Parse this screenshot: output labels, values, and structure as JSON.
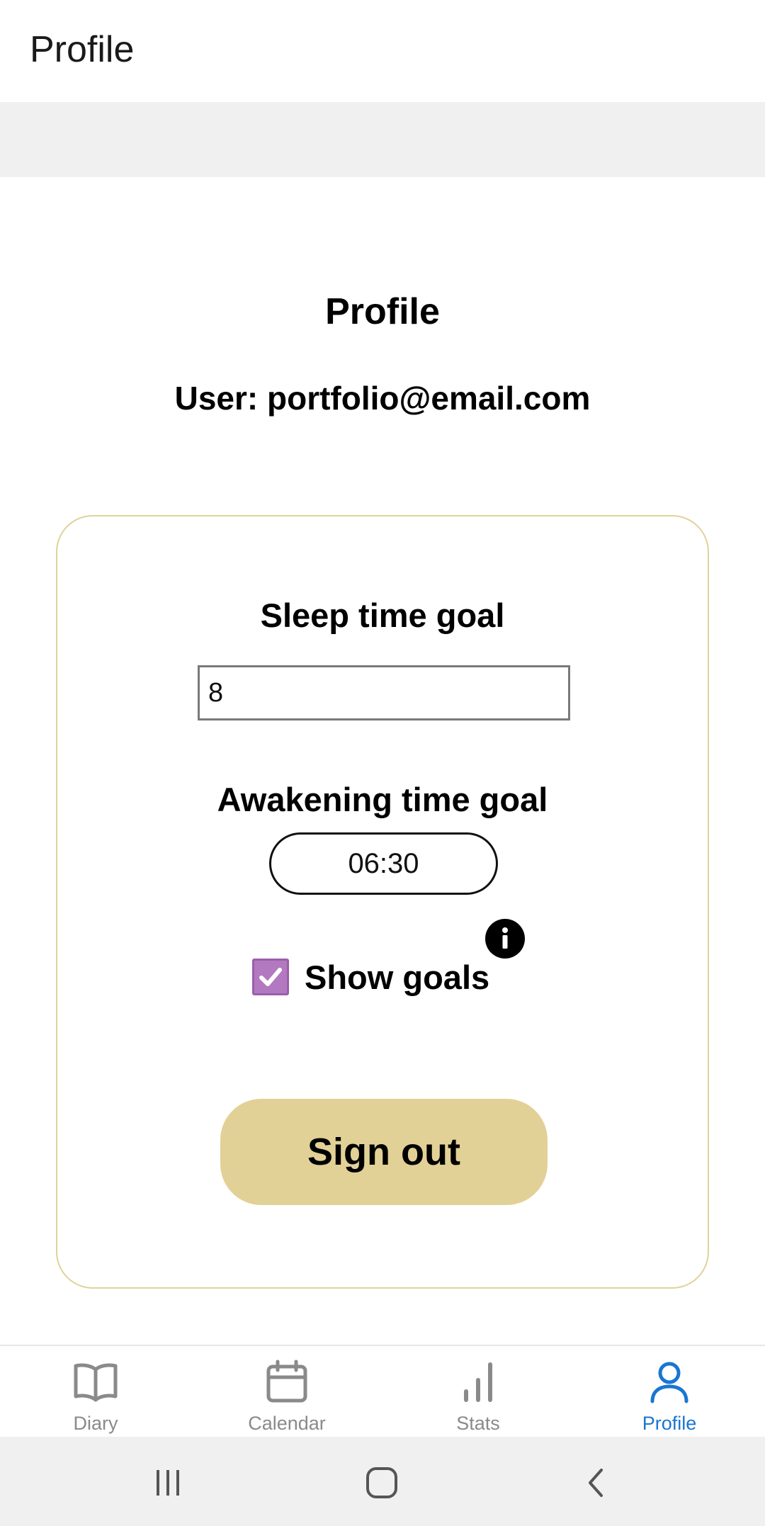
{
  "header": {
    "title": "Profile"
  },
  "main": {
    "title": "Profile",
    "user_line": "User: portfolio@email.com"
  },
  "goals": {
    "sleep_label": "Sleep time goal",
    "sleep_value": "8",
    "awakening_label": "Awakening time goal",
    "awakening_value": "06:30",
    "show_goals_label": "Show goals",
    "show_goals_checked": true,
    "sign_out_label": "Sign out"
  },
  "nav": {
    "items": [
      {
        "label": "Diary",
        "icon": "book-icon"
      },
      {
        "label": "Calendar",
        "icon": "calendar-icon"
      },
      {
        "label": "Stats",
        "icon": "bar-chart-icon"
      },
      {
        "label": "Profile",
        "icon": "user-icon",
        "active": true
      }
    ]
  },
  "colors": {
    "accent": "#e2d196",
    "card_border": "#e0d29a",
    "checkbox": "#b278c0",
    "nav_active": "#1976d2",
    "nav_inactive": "#8a8a8a"
  }
}
